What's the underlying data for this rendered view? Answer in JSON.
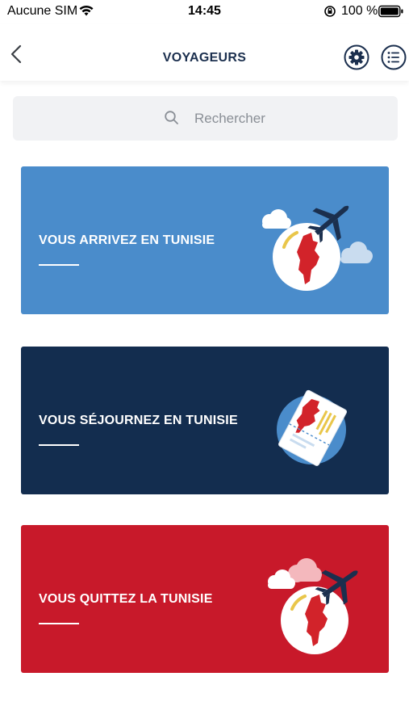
{
  "status_bar": {
    "carrier": "Aucune SIM",
    "time": "14:45",
    "battery_percent": "100 %"
  },
  "nav": {
    "title": "VOYAGEURS",
    "back_icon": "chevron-left-icon",
    "settings_icon": "gear-icon",
    "menu_icon": "list-icon"
  },
  "search": {
    "placeholder": "Rechercher",
    "icon": "search-icon"
  },
  "cards": [
    {
      "label": "VOUS ARRIVEZ EN TUNISIE",
      "color": "#4a8ccb",
      "icon": "globe-plane-icon"
    },
    {
      "label": "VOUS SÉJOURNEZ EN TUNISIE",
      "color": "#132d4f",
      "icon": "passport-ticket-icon"
    },
    {
      "label": "VOUS QUITTEZ LA TUNISIE",
      "color": "#c8192a",
      "icon": "globe-plane-departure-icon"
    }
  ],
  "colors": {
    "navy": "#1b2f4e",
    "tunisia_red": "#d2232a",
    "blue": "#4a8ccb"
  }
}
